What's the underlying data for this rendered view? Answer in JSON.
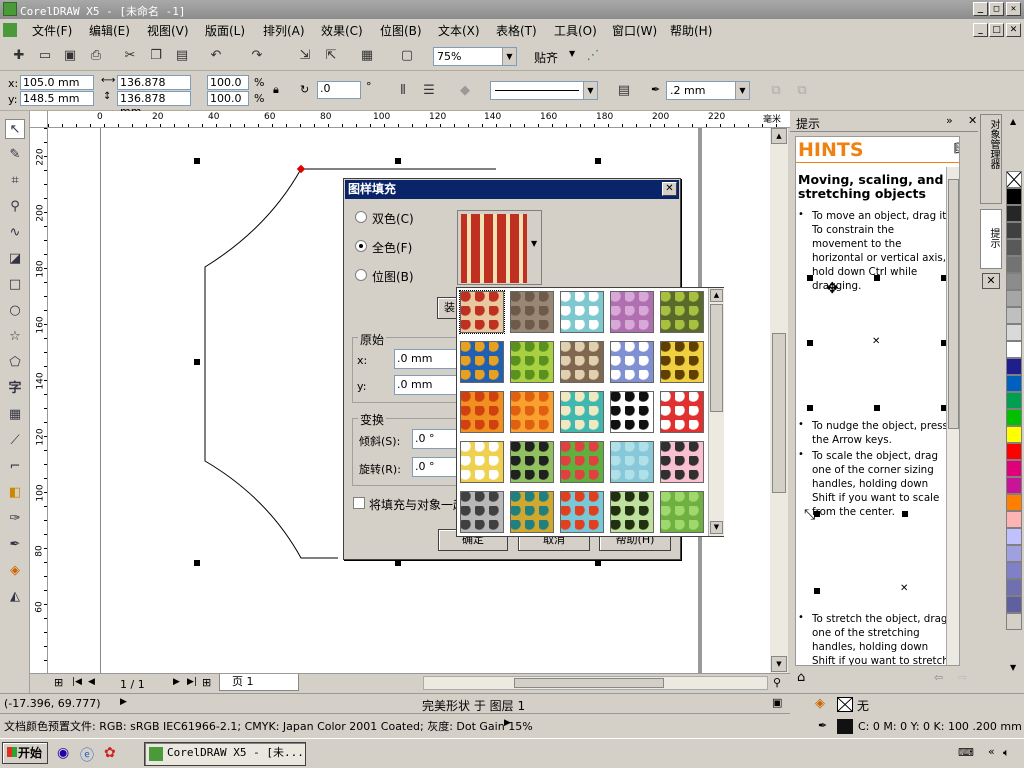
{
  "window": {
    "title": "CorelDRAW X5 - [未命名 -1]"
  },
  "menu": [
    "文件(F)",
    "编辑(E)",
    "视图(V)",
    "版面(L)",
    "排列(A)",
    "效果(C)",
    "位图(B)",
    "文本(X)",
    "表格(T)",
    "工具(O)",
    "窗口(W)",
    "帮助(H)"
  ],
  "toolbar": {
    "zoom": "75%",
    "snap_label": "贴齐"
  },
  "propbar": {
    "x_label": "x:",
    "x": "105.0 mm",
    "y_label": "y:",
    "y": "148.5 mm",
    "w": "136.878 mm",
    "h": "136.878 mm",
    "scale_w": "100.0",
    "scale_h": "100.0",
    "pct": "%",
    "rotation": ".0",
    "deg": "°",
    "outline_width": ".2 mm"
  },
  "hruler": {
    "ticks": [
      "0",
      "20",
      "40",
      "60",
      "80",
      "100",
      "120",
      "140",
      "160",
      "180",
      "200",
      "220"
    ],
    "unit": "毫米"
  },
  "vruler": {
    "ticks": [
      "220",
      "200",
      "180",
      "160",
      "140",
      "120",
      "100",
      "80",
      "60"
    ]
  },
  "pager": {
    "count": "1 / 1",
    "page_tab": "页 1"
  },
  "dialog": {
    "title": "图样填充",
    "opt_two": "双色(C)",
    "opt_full": "全色(F)",
    "opt_bitmap": "位图(B)",
    "load_button": "装",
    "origin_label": "原始",
    "ox_label": "x:",
    "ox": ".0 mm",
    "oy_label": "y:",
    "oy": ".0 mm",
    "transform_label": "变换",
    "skew_label": "倾斜(S):",
    "skew": ".0 °",
    "rotate_label": "旋转(R):",
    "rotate": ".0 °",
    "fill_checkbox": "将填充与对象一起",
    "ok": "确定",
    "cancel": "取消",
    "help": "帮助(H)"
  },
  "panel": {
    "header": "提示",
    "hints_title": "HINTS",
    "topic": "Moving, scaling, and stretching objects",
    "b1": "To move an object, drag it. To constrain the movement to the horizontal or vertical axis, hold down Ctrl while dragging.",
    "b2": "To nudge the object, press the Arrow keys.",
    "b3": "To scale the object, drag one of the corner sizing handles, holding down Shift if you want to scale from the center.",
    "b4": "To stretch the object, drag one of the stretching handles, holding down Shift if you want to stretch from the",
    "tab1": "对象管理器",
    "tab2": "提示"
  },
  "statusbar": {
    "coords": "(-17.396, 69.777)",
    "object_info": "完美形状 于 图层 1",
    "color_profile": "文档颜色预置文件: RGB: sRGB IEC61966-2.1; CMYK: Japan Color 2001 Coated; 灰度: Dot Gain 15%",
    "fill_none": "无",
    "outline_info": "C: 0 M: 0 Y: 0 K: 100  .200 mm"
  },
  "taskbar": {
    "start": "开始",
    "task": "CorelDRAW X5 - [未..."
  },
  "palette_colors": [
    "#ffffff",
    "#000000",
    "#262626",
    "#404040",
    "#595959",
    "#737373",
    "#8c8c8c",
    "#a6a6a6",
    "#bfbfbf",
    "#d9d9d9",
    "#ffffff",
    "#1e1e8c",
    "#0060c0",
    "#00a050",
    "#00c000",
    "#ffff00",
    "#ff0000",
    "#e0007a",
    "#c81496",
    "#ff8000",
    "#ffb4b4",
    "#c0c0ff",
    "#a0a0e0",
    "#8080c8",
    "#7070b0",
    "#6060a0"
  ],
  "pattern_tiles": [
    {
      "bg": "#e8c8a0",
      "fg": "#c03020"
    },
    {
      "bg": "#9a8674",
      "fg": "#6d5a48"
    },
    {
      "bg": "#7ec8d0",
      "fg": "#ffffff"
    },
    {
      "bg": "#b070b0",
      "fg": "#d8a8d8"
    },
    {
      "bg": "#5a6a2a",
      "fg": "#a8c040"
    },
    {
      "bg": "#2060b0",
      "fg": "#e8a020"
    },
    {
      "bg": "#a8d040",
      "fg": "#5a9020"
    },
    {
      "bg": "#806850",
      "fg": "#e0d0b0"
    },
    {
      "bg": "#8090d0",
      "fg": "#ffffff"
    },
    {
      "bg": "#f0d040",
      "fg": "#604000"
    },
    {
      "bg": "#f09020",
      "fg": "#d04010"
    },
    {
      "bg": "#f8a030",
      "fg": "#e06010"
    },
    {
      "bg": "#40b8b0",
      "fg": "#f0e8c0"
    },
    {
      "bg": "#ffffff",
      "fg": "#101010"
    },
    {
      "bg": "#e03030",
      "fg": "#ffffff"
    },
    {
      "bg": "#f0d050",
      "fg": "#ffffff"
    },
    {
      "bg": "#90c060",
      "fg": "#202020"
    },
    {
      "bg": "#60b040",
      "fg": "#e04040"
    },
    {
      "bg": "#88c8d8",
      "fg": "#b0e0e8"
    },
    {
      "bg": "#f8c0d0",
      "fg": "#303030"
    },
    {
      "bg": "#b8b8b8",
      "fg": "#404040"
    },
    {
      "bg": "#d0a830",
      "fg": "#208080"
    },
    {
      "bg": "#78c8d8",
      "fg": "#e04020"
    },
    {
      "bg": "#c0e0a0",
      "fg": "#203010"
    },
    {
      "bg": "#70b040",
      "fg": "#a0d870"
    }
  ]
}
